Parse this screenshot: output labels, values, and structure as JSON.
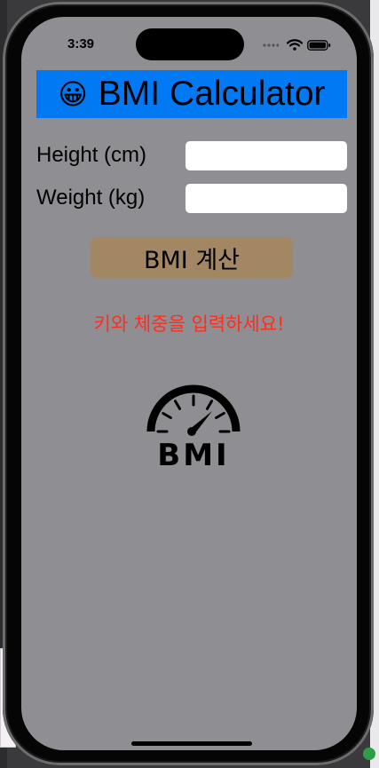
{
  "status_bar": {
    "time": "3:39"
  },
  "header": {
    "emoji": "😀",
    "title": "BMI Calculator"
  },
  "form": {
    "height_label": "Height (cm)",
    "height_value": "",
    "weight_label": "Weight (kg)",
    "weight_value": ""
  },
  "actions": {
    "calculate_label": "BMI 계산"
  },
  "result": {
    "message": "키와 체중을 입력하세요!"
  },
  "logo": {
    "text": "BMI",
    "icon": "speedometer-icon"
  },
  "colors": {
    "screen_background": "#8e8e93",
    "title_background": "#0079f2",
    "button_background": "#a38764",
    "message_color": "#ff2d1f"
  }
}
